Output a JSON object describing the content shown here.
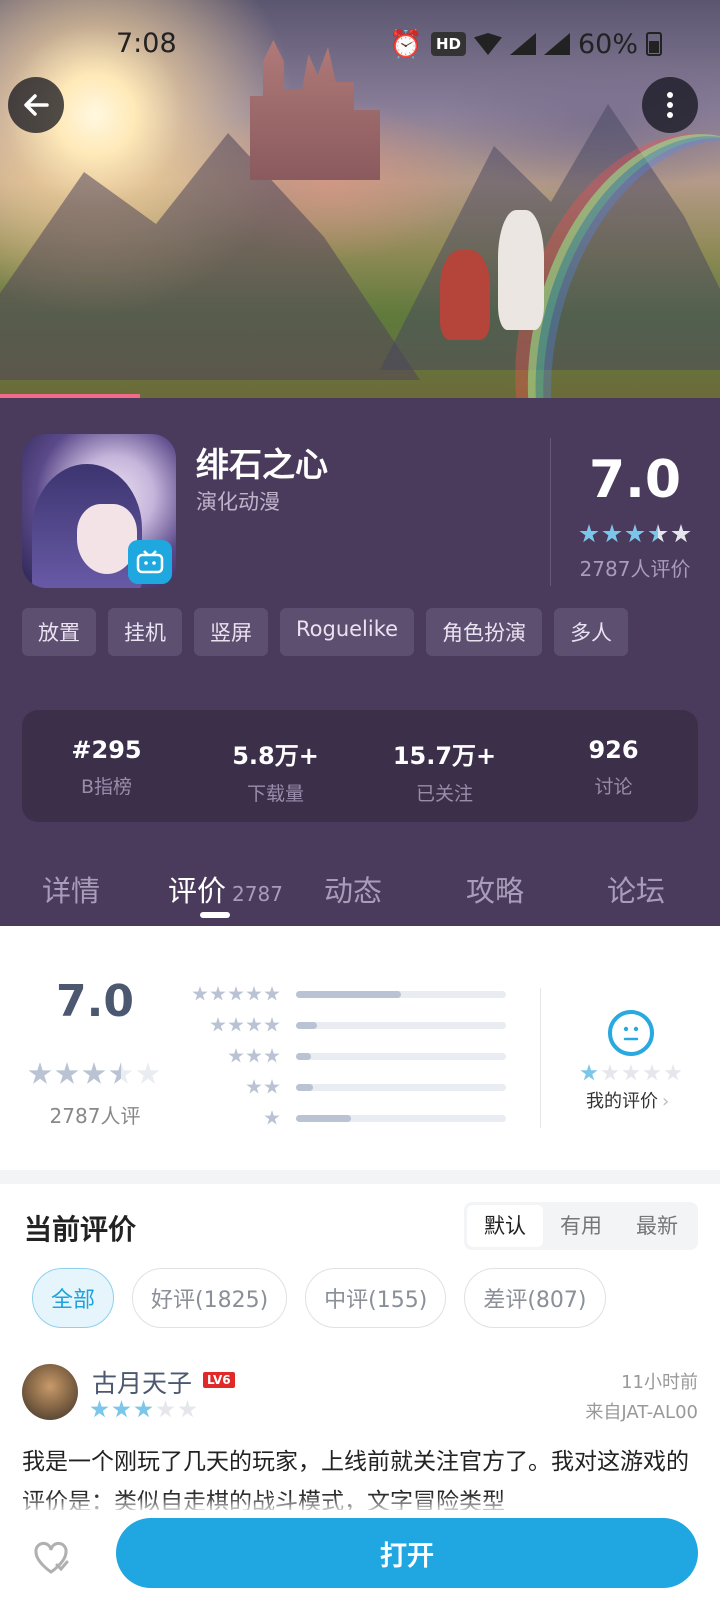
{
  "status_bar": {
    "time": "7:08",
    "hd": "HD",
    "battery": "60%"
  },
  "app": {
    "name": "绯石之心",
    "developer": "演化动漫",
    "score": "7.0",
    "star_rating": 3.5,
    "raters": "2787人评价"
  },
  "tags": [
    "放置",
    "挂机",
    "竖屏",
    "Roguelike",
    "角色扮演",
    "多人"
  ],
  "stats": [
    {
      "value": "#295",
      "label": "B指榜"
    },
    {
      "value": "5.8万+",
      "label": "下载量"
    },
    {
      "value": "15.7万+",
      "label": "已关注"
    },
    {
      "value": "926",
      "label": "讨论"
    }
  ],
  "tabs": {
    "details": "详情",
    "reviews": "评价",
    "reviews_count": "2787",
    "news": "动态",
    "guides": "攻略",
    "forum": "论坛"
  },
  "rating_summary": {
    "score": "7.0",
    "raters": "2787人评",
    "distribution": [
      {
        "stars": 5,
        "fraction": 0.5
      },
      {
        "stars": 4,
        "fraction": 0.1
      },
      {
        "stars": 3,
        "fraction": 0.07
      },
      {
        "stars": 2,
        "fraction": 0.08
      },
      {
        "stars": 1,
        "fraction": 0.26
      }
    ],
    "my_rating_label": "我的评价",
    "my_rating_stars": 1
  },
  "current_reviews": {
    "title": "当前评价",
    "sort": [
      "默认",
      "有用",
      "最新"
    ],
    "filters": [
      "全部",
      "好评(1825)",
      "中评(155)",
      "差评(807)"
    ]
  },
  "review": {
    "user": "古月天子",
    "level": "LV6",
    "stars": 3,
    "time": "11小时前",
    "device": "来自JAT-AL00",
    "text": "我是一个刚玩了几天的玩家，上线前就关注官方了。我对这游戏的评价是：类似自走棋的战斗模式，文字冒险类型"
  },
  "bottom": {
    "open_label": "打开"
  },
  "colors": {
    "accent": "#20a6e0",
    "header_bg": "#4a3a5b",
    "star": "#7cc6ea"
  }
}
